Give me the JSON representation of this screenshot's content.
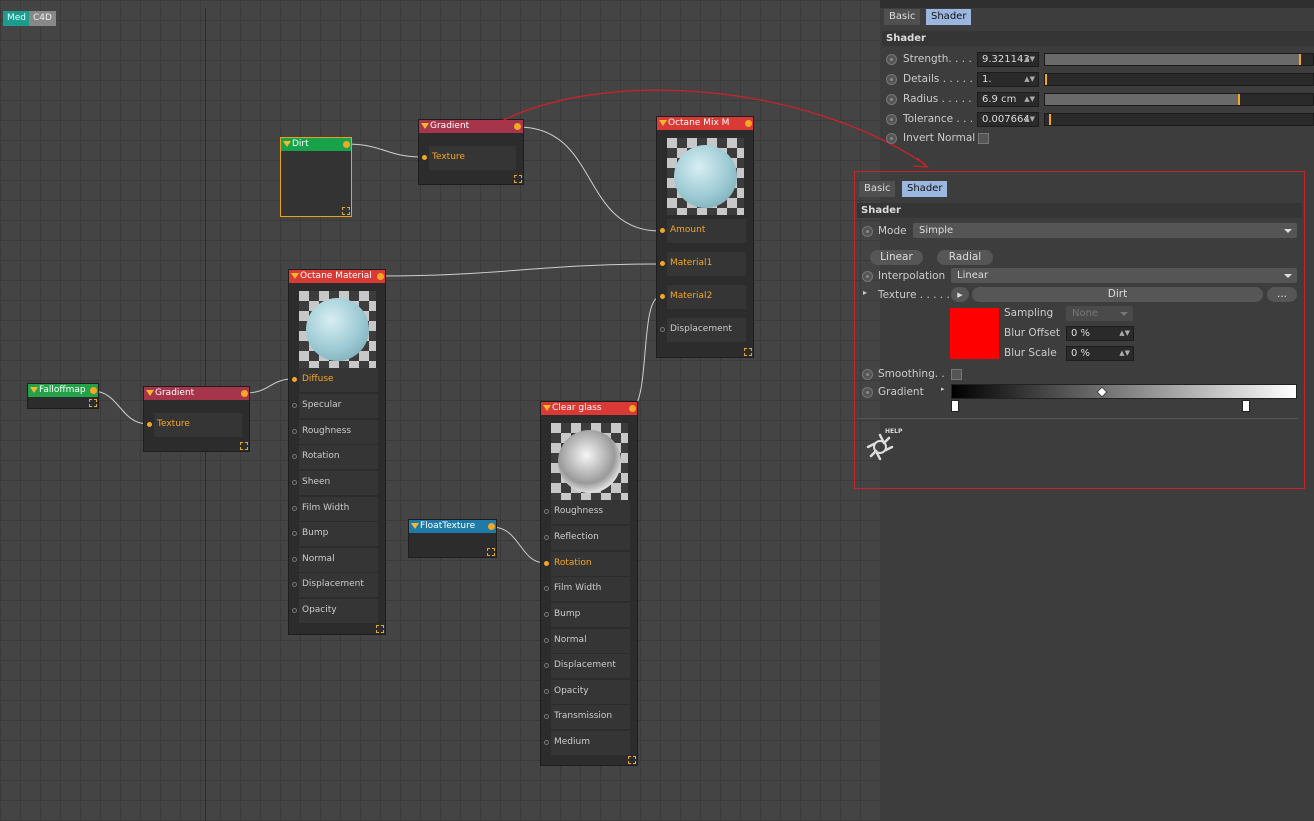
{
  "canvas_tabs": {
    "med": "Med",
    "c4d": "C4D"
  },
  "nodes": {
    "dirt": {
      "title": "Dirt"
    },
    "gradient_top": {
      "title": "Gradient",
      "port": "Texture"
    },
    "mix": {
      "title": "Octane Mix M",
      "ports": [
        "Amount",
        "Material1",
        "Material2",
        "Displacement"
      ]
    },
    "material": {
      "title": "Octane Material",
      "ports": [
        "Diffuse",
        "Specular",
        "Roughness",
        "Rotation",
        "Sheen",
        "Film Width",
        "Bump",
        "Normal",
        "Displacement",
        "Opacity"
      ]
    },
    "falloff": {
      "title": "Falloffmap"
    },
    "gradient_left": {
      "title": "Gradient",
      "port": "Texture"
    },
    "float": {
      "title": "FloatTexture"
    },
    "glass": {
      "title": "Clear glass",
      "ports": [
        "Roughness",
        "Reflection",
        "Rotation",
        "Film Width",
        "Bump",
        "Normal",
        "Displacement",
        "Opacity",
        "Transmission",
        "Medium"
      ]
    }
  },
  "panel1": {
    "tabs": [
      "Basic",
      "Shader"
    ],
    "section": "Shader",
    "strength": {
      "label": "Strength. . . .",
      "value": "9.321143",
      "level": 0.97
    },
    "details": {
      "label": "Details . . . . .",
      "value": "1.",
      "level": 0.0
    },
    "radius": {
      "label": "Radius . . . . .",
      "value": "6.9 cm",
      "level": 0.7
    },
    "tolerance": {
      "label": "Tolerance . . .",
      "value": "0.007664",
      "level": 0.01
    },
    "invert_normal": {
      "label": "Invert Normal"
    }
  },
  "panel2": {
    "tabs": [
      "Basic",
      "Shader"
    ],
    "section": "Shader",
    "mode": {
      "label": "Mode",
      "value": "Simple"
    },
    "buttons": {
      "linear": "Linear",
      "radial": "Radial"
    },
    "interpolation": {
      "label": "Interpolation",
      "value": "Linear"
    },
    "texture": {
      "label": "Texture . . . . .",
      "value": "Dirt",
      "more": "..."
    },
    "sampling": {
      "label": "Sampling",
      "value": "None"
    },
    "blur_offset": {
      "label": "Blur Offset",
      "value": "0 %"
    },
    "blur_scale": {
      "label": "Blur Scale",
      "value": "0 %"
    },
    "smoothing": {
      "label": "Smoothing. ."
    },
    "gradient": {
      "label": "Gradient"
    },
    "help": "HELP",
    "swatch_color": "#ff0000"
  },
  "colors": {
    "accent": "#f5a623",
    "annotation": "#c9232a",
    "tab_active": "#9bb7e0"
  }
}
